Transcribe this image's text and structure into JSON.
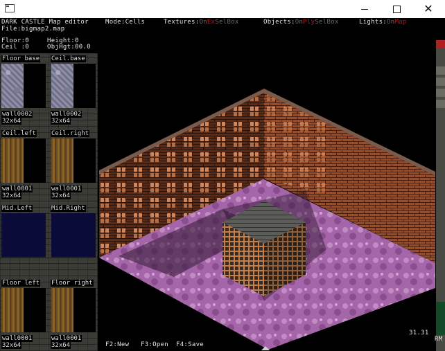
{
  "header": {
    "app_name": "DARK CASTLE Map editor",
    "file_label": "File:bigmap2.map",
    "mode_label": "Mode:Cells",
    "textures_label": "Textures:",
    "textures_on": "On",
    "textures_ex": "Ex",
    "textures_sel": "SelBox",
    "objects_label": "Objects:",
    "objects_on": "On",
    "objects_ply": "Ply",
    "objects_sel": "SelBox",
    "lights_label": "Lights:",
    "lights_on": "On",
    "lights_map": "Map"
  },
  "props": {
    "floor": "Floor:0",
    "height": "Height:0",
    "ceil": "Ceil :0",
    "objhgt": "ObjHgt:00.0"
  },
  "panels": [
    {
      "left_label": "Floor base",
      "right_label": "Ceil.base",
      "left_name": "wall0002",
      "left_size": "32x64",
      "right_name": "wall0002",
      "right_size": "32x64",
      "kind": "stone"
    },
    {
      "left_label": "Ceil.left",
      "right_label": "Ceil.right",
      "left_name": "wall0001",
      "left_size": "32x64",
      "right_name": "wall0001",
      "right_size": "32x64",
      "kind": "wood"
    },
    {
      "left_label": "Mid.Left",
      "right_label": "Mid.Right",
      "kind": "navy"
    },
    {
      "left_label": "Floor left",
      "right_label": "Floor right",
      "left_name": "wall0001",
      "left_size": "32x64",
      "right_name": "wall0001",
      "right_size": "32x64",
      "kind": "wood"
    }
  ],
  "footer": {
    "f2": "F2:New",
    "f3": "F3:Open",
    "f4": "F4:Save",
    "fps": "31.31",
    "rm": "RM"
  },
  "colors": {
    "accent_red": "#c01818",
    "brick": "#a0522d",
    "floor": "#b070b0"
  }
}
